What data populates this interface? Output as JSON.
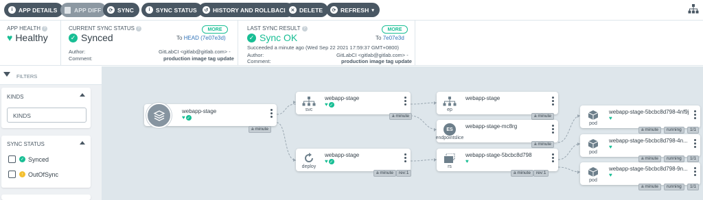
{
  "toolbar": {
    "buttons": [
      {
        "label": "APP DETAILS",
        "icon": "info-icon"
      },
      {
        "label": "APP DIFF",
        "icon": "file-icon"
      },
      {
        "label": "SYNC",
        "icon": "sync-icon"
      },
      {
        "label": "SYNC STATUS",
        "icon": "info-icon"
      },
      {
        "label": "HISTORY AND ROLLBACK",
        "icon": "history-icon"
      },
      {
        "label": "DELETE",
        "icon": "close-icon"
      },
      {
        "label": "REFRESH",
        "icon": "refresh-icon"
      }
    ]
  },
  "status": {
    "app_health": {
      "label": "APP HEALTH",
      "value": "Healthy"
    },
    "current_sync": {
      "label": "CURRENT SYNC STATUS",
      "value": "Synced",
      "more": "MORE",
      "to_prefix": "To",
      "to_link": "HEAD (7e07e3d)",
      "author_label": "Author:",
      "author_value": "GitLabCI <gitlab@gitlab.com> -",
      "comment_label": "Comment:",
      "comment_value": "production image tag update"
    },
    "last_sync": {
      "label": "LAST SYNC RESULT",
      "value": "Sync OK",
      "more": "MORE",
      "to_prefix": "To",
      "to_link": "7e07e3d",
      "succeeded": "Succeeded a minute ago (Wed Sep 22 2021 17:59:37 GMT+0800)",
      "author_label": "Author:",
      "author_value": "GitLabCI <gitlab@gitlab.com> -",
      "comment_label": "Comment:",
      "comment_value": "production image tag update"
    }
  },
  "filters": {
    "title": "FILTERS",
    "kinds": {
      "title": "KINDS",
      "placeholder": "KINDS"
    },
    "sync_status": {
      "title": "SYNC STATUS",
      "options": [
        "Synced",
        "OutOfSync"
      ]
    }
  },
  "graph": {
    "app": {
      "name": "webapp-stage",
      "age": "a minute"
    },
    "svc": {
      "name": "webapp-stage",
      "kind": "svc",
      "age": "a minute"
    },
    "deploy": {
      "name": "webapp-stage",
      "kind": "deploy",
      "age": "a minute",
      "rev": "rev:1"
    },
    "ep": {
      "name": "webapp-stage",
      "kind": "ep",
      "age": "a minute"
    },
    "endpointslice": {
      "name": "webapp-stage-mc8rg",
      "kind": "endpointslice",
      "badge": "ES",
      "age": "a minute"
    },
    "rs": {
      "name": "webapp-stage-5bcbc8d798",
      "kind": "rs",
      "age": "a minute",
      "rev": "rev:1"
    },
    "pods": [
      {
        "name": "webapp-stage-5bcbc8d798-4nf9j",
        "kind": "pod",
        "age": "a minute",
        "status": "running",
        "ready": "1/1"
      },
      {
        "name": "webapp-stage-5bcbc8d798-4n...",
        "kind": "pod",
        "age": "a minute",
        "status": "running",
        "ready": "1/1"
      },
      {
        "name": "webapp-stage-5bcbc8d798-9n...",
        "kind": "pod",
        "age": "a minute",
        "status": "running",
        "ready": "1/1"
      }
    ]
  },
  "colors": {
    "accent": "#18be94",
    "dark": "#495763",
    "link": "#2f72b8",
    "canvas": "#dee6eb",
    "out_of_sync": "#f4c030"
  }
}
